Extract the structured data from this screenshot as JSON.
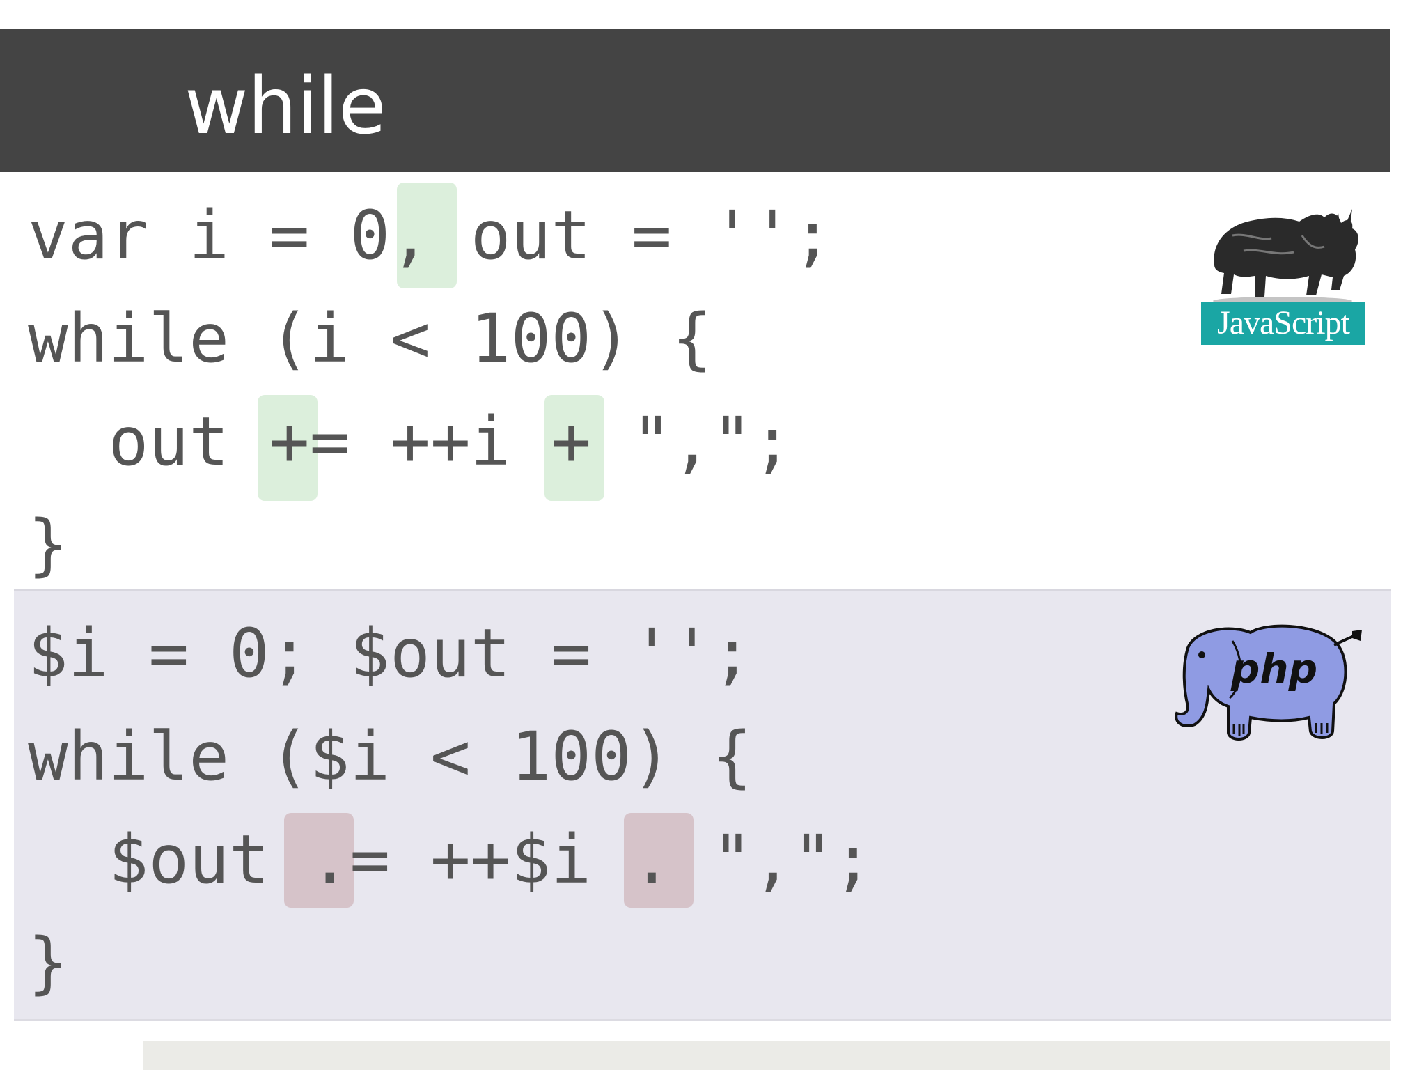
{
  "slide": {
    "title": "while"
  },
  "javascript": {
    "logo_label": "JavaScript",
    "lines": [
      "var i = 0, out = '';",
      "while (i < 100) {",
      "  out += ++i + \",\";",
      "}"
    ]
  },
  "php": {
    "logo_label": "php",
    "lines": [
      "$i = 0; $out = '';",
      "while ($i < 100) {",
      "  $out .= ++$i . \",\";",
      "}"
    ]
  },
  "colors": {
    "title_bar": "#444444",
    "code_text": "#555555",
    "js_highlight": "#dcefdc",
    "php_highlight": "#d6c3c9",
    "php_panel": "#e8e7ef",
    "js_banner": "#1aa6a4"
  },
  "icons": {
    "javascript_logo": "rhino-icon",
    "php_logo": "elephant-icon"
  }
}
